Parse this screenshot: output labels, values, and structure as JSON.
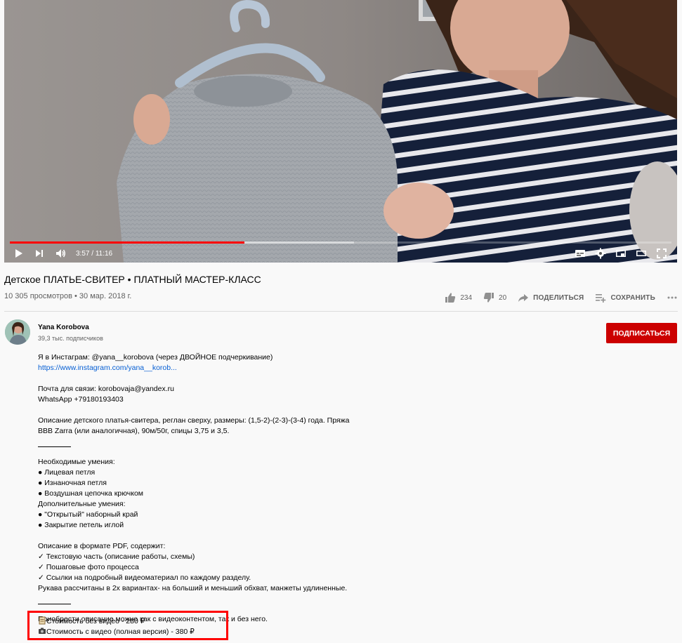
{
  "player": {
    "current_time": "3:57",
    "separator": " / ",
    "duration": "11:16",
    "played_fraction": 0.355,
    "controls": [
      "play-icon",
      "next-icon",
      "volume-icon",
      "subtitles-icon",
      "settings-icon",
      "miniplayer-icon",
      "theater-icon",
      "fullscreen-icon"
    ]
  },
  "video": {
    "title": "Детское ПЛАТЬЕ-СВИТЕР • ПЛАТНЫЙ МАСТЕР-КЛАСС",
    "meta": "10 305 просмотров • 30 мар. 2018 г."
  },
  "actions": {
    "likes": "234",
    "dislikes": "20",
    "share": "ПОДЕЛИТЬСЯ",
    "save": "СОХРАНИТЬ"
  },
  "channel": {
    "name": "Yana Korobova",
    "subscribers": "39,3 тыс. подписчиков",
    "subscribe_label": "ПОДПИСАТЬСЯ"
  },
  "description": {
    "instagram": "Я в Инстаграм: @yana__korobova (через ДВОЙНОЕ подчеркивание)",
    "instagram_link": "https://www.instagram.com/yana__korob...",
    "email": "Почта для связи: korobovaja@yandex.ru",
    "whatsapp": "WhatsApp +79180193403",
    "about_1": "Описание детского платья-свитера, реглан сверху, размеры: (1,5-2)-(2-3)-(3-4) года. Пряжа",
    "about_2": "ВВВ Zarra (или аналогичная), 90м/50г, спицы 3,75 и 3,5.",
    "skills_title": "Необходимые умения:",
    "skill_1": "● Лицевая петля",
    "skill_2": "● Изнаночная петля",
    "skill_3": "● Воздушная цепочка крючком",
    "extra_title": "Дополнительные умения:",
    "extra_1": "● \"Открытый\" наборный край",
    "extra_2": "●  Закрытие петель иглой",
    "pdf_title": "Описание в формате PDF, содержит:",
    "pdf_1": "✓ Текстовую часть (описание работы, схемы)",
    "pdf_2": "✓ Пошаговые фото процесса",
    "pdf_3": "✓ Ссылки на подробный видеоматериал по каждому разделу.",
    "pdf_4": "Рукава рассчитаны в 2х вариантах- на больший и меньший обхват, манжеты удлиненные.",
    "buy": "Приобрести описание можно как с видеоконтентом, так и без него.",
    "price_no_video": "Стоимость без видео - 280 ₽",
    "price_with_video": "Стоимость с видео (полная версия) - 380 ₽"
  },
  "colors": {
    "progress": "#ff0000",
    "subscribe": "#cc0000",
    "link": "#065fd4",
    "highlight_box": "#ff0000"
  }
}
